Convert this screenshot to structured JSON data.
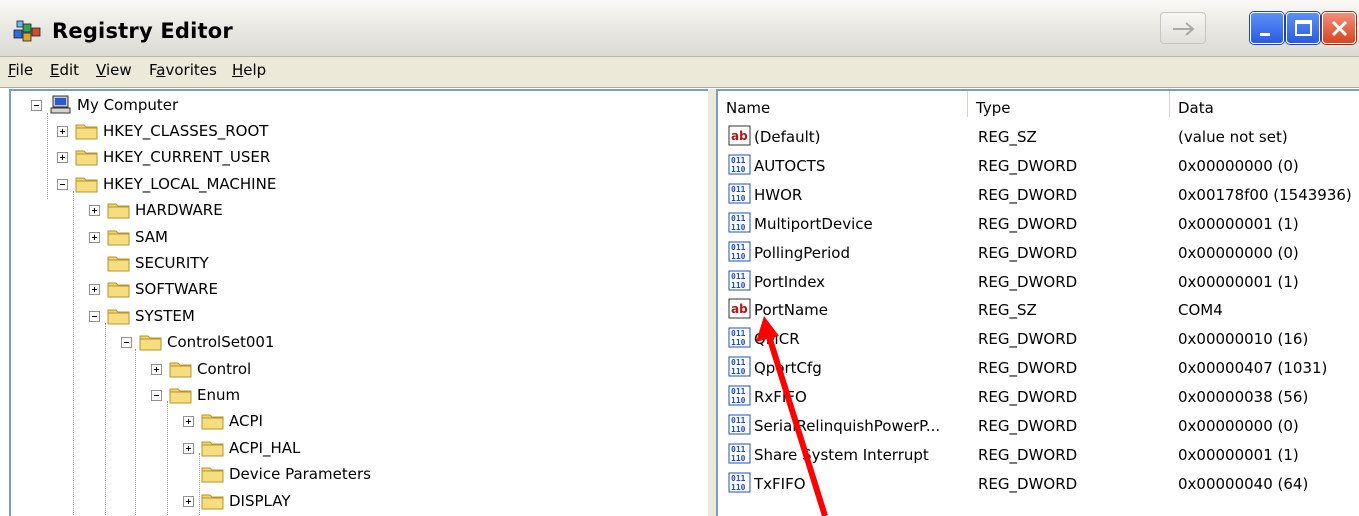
{
  "window": {
    "title": "Registry Editor",
    "controls": {
      "back_icon": "arrow-right-icon",
      "minimize_icon": "minimize-icon",
      "maximize_icon": "maximize-icon",
      "close_icon": "close-icon"
    }
  },
  "menu": [
    {
      "label": "File",
      "u": "F",
      "rest": "ile"
    },
    {
      "label": "Edit",
      "u": "E",
      "rest": "dit"
    },
    {
      "label": "View",
      "u": "V",
      "rest": "iew"
    },
    {
      "label": "Favorites",
      "u": "a",
      "pre": "F",
      "rest": "vorites"
    },
    {
      "label": "Help",
      "u": "H",
      "rest": "elp"
    }
  ],
  "tree": {
    "root": "My Computer",
    "nodes": [
      {
        "label": "HKEY_CLASSES_ROOT",
        "expanded": false
      },
      {
        "label": "HKEY_CURRENT_USER",
        "expanded": false
      },
      {
        "label": "HKEY_LOCAL_MACHINE",
        "expanded": true
      },
      {
        "label": "HARDWARE",
        "expanded": false
      },
      {
        "label": "SAM",
        "expanded": false
      },
      {
        "label": "SECURITY",
        "expanded": null
      },
      {
        "label": "SOFTWARE",
        "expanded": false
      },
      {
        "label": "SYSTEM",
        "expanded": true
      },
      {
        "label": "ControlSet001",
        "expanded": true
      },
      {
        "label": "Control",
        "expanded": false
      },
      {
        "label": "Enum",
        "expanded": true
      },
      {
        "label": "ACPI",
        "expanded": false
      },
      {
        "label": "ACPI_HAL",
        "expanded": false
      },
      {
        "label": "Device Parameters",
        "expanded": null
      },
      {
        "label": "DISPLAY",
        "expanded": false
      }
    ]
  },
  "list": {
    "columns": {
      "name": "Name",
      "type": "Type",
      "data": "Data"
    },
    "rows": [
      {
        "icon": "string-value-icon",
        "name": "(Default)",
        "type": "REG_SZ",
        "data": "(value not set)"
      },
      {
        "icon": "binary-value-icon",
        "name": "AUTOCTS",
        "type": "REG_DWORD",
        "data": "0x00000000 (0)"
      },
      {
        "icon": "binary-value-icon",
        "name": "HWOR",
        "type": "REG_DWORD",
        "data": "0x00178f00 (1543936)"
      },
      {
        "icon": "binary-value-icon",
        "name": "MultiportDevice",
        "type": "REG_DWORD",
        "data": "0x00000001 (1)"
      },
      {
        "icon": "binary-value-icon",
        "name": "PollingPeriod",
        "type": "REG_DWORD",
        "data": "0x00000000 (0)"
      },
      {
        "icon": "binary-value-icon",
        "name": "PortIndex",
        "type": "REG_DWORD",
        "data": "0x00000001 (1)"
      },
      {
        "icon": "string-value-icon",
        "name": "PortName",
        "type": "REG_SZ",
        "data": "COM4"
      },
      {
        "icon": "binary-value-icon",
        "name": "QMCR",
        "type": "REG_DWORD",
        "data": "0x00000010 (16)"
      },
      {
        "icon": "binary-value-icon",
        "name": "QportCfg",
        "type": "REG_DWORD",
        "data": "0x00000407 (1031)"
      },
      {
        "icon": "binary-value-icon",
        "name": "RxFIFO",
        "type": "REG_DWORD",
        "data": "0x00000038 (56)"
      },
      {
        "icon": "binary-value-icon",
        "name": "SerialRelinquishPowerP...",
        "type": "REG_DWORD",
        "data": "0x00000000 (0)"
      },
      {
        "icon": "binary-value-icon",
        "name": "Share System Interrupt",
        "type": "REG_DWORD",
        "data": "0x00000001 (1)"
      },
      {
        "icon": "binary-value-icon",
        "name": "TxFIFO",
        "type": "REG_DWORD",
        "data": "0x00000040 (64)"
      }
    ]
  },
  "annotation": {
    "type": "arrow",
    "color": "#ff0000",
    "points_to": "PortName"
  }
}
